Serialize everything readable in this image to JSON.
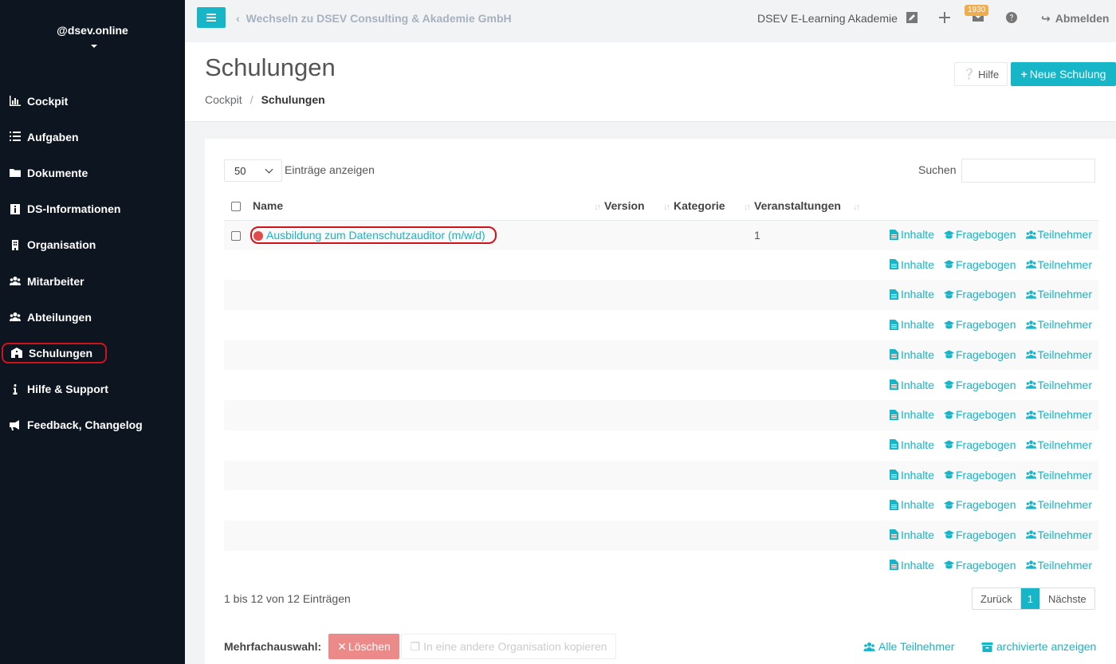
{
  "sidebar": {
    "user": "@dsev.online",
    "items": [
      {
        "label": "Cockpit",
        "icon": "chart-icon"
      },
      {
        "label": "Aufgaben",
        "icon": "list-icon"
      },
      {
        "label": "Dokumente",
        "icon": "folder-icon"
      },
      {
        "label": "DS-Informationen",
        "icon": "info-square-icon"
      },
      {
        "label": "Organisation",
        "icon": "building-icon"
      },
      {
        "label": "Mitarbeiter",
        "icon": "users-icon"
      },
      {
        "label": "Abteilungen",
        "icon": "users-icon"
      },
      {
        "label": "Schulungen",
        "icon": "school-icon"
      },
      {
        "label": "Hilfe & Support",
        "icon": "info-icon"
      },
      {
        "label": "Feedback, Changelog",
        "icon": "megaphone-icon"
      }
    ]
  },
  "topbar": {
    "switch_label": "Wechseln zu DSEV Consulting & Akademie GmbH",
    "academy": "DSEV E-Learning Akademie",
    "mail_badge": "1930",
    "logout": "Abmelden"
  },
  "page": {
    "title": "Schulungen",
    "breadcrumb_home": "Cockpit",
    "breadcrumb_current": "Schulungen",
    "help_button": "Hilfe",
    "new_button": "Neue Schulung"
  },
  "table": {
    "length_value": "50",
    "length_label": "Einträge anzeigen",
    "search_label": "Suchen",
    "columns": {
      "name": "Name",
      "version": "Version",
      "category": "Kategorie",
      "events": "Veranstaltungen"
    },
    "first_row": {
      "name": "Ausbildung zum Datenschutzauditor (m/w/d)",
      "events": "1"
    },
    "actions": {
      "contents": "Inhalte",
      "questionnaire": "Fragebogen",
      "participants": "Teilnehmer"
    },
    "row_count": 12,
    "info": "1 bis 12 von 12 Einträgen",
    "pager": {
      "prev": "Zurück",
      "current": "1",
      "next": "Nächste"
    }
  },
  "bulk": {
    "label": "Mehrfachauswahl:",
    "delete": "Löschen",
    "copy": "In eine andere Organisation kopieren",
    "all_participants": "Alle Teilnehmer",
    "archived": "archivierte anzeigen"
  },
  "colors": {
    "accent": "#17b5c8",
    "sidebar_bg": "#0d1520",
    "highlight_red": "#d0121b",
    "status_dot": "#e04b4b"
  }
}
